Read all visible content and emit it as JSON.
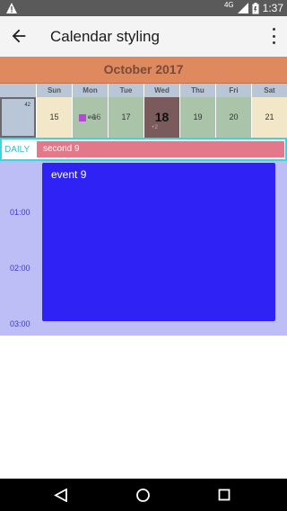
{
  "status_bar": {
    "time": "1:37",
    "network": "4G",
    "icons": [
      "warning-icon",
      "signal-icon",
      "battery-icon"
    ]
  },
  "app_bar": {
    "title": "Calendar styling",
    "icons": [
      "back-arrow-icon",
      "more-vert-icon"
    ]
  },
  "calendar": {
    "month_title": "October 2017",
    "weekdays": [
      "Sun",
      "Mon",
      "Tue",
      "Wed",
      "Thu",
      "Fri",
      "Sat"
    ],
    "week_number": "42",
    "days": [
      {
        "number": "15",
        "color": "#f2e8c8"
      },
      {
        "number": "16",
        "color": "#a9c4a8",
        "event_text": "eve",
        "event_color": "#b24ad6"
      },
      {
        "number": "17",
        "color": "#a9c4a8"
      },
      {
        "number": "18",
        "color": "#7a5a5a",
        "today": true,
        "extra": "+2"
      },
      {
        "number": "19",
        "color": "#a9c4a8"
      },
      {
        "number": "20",
        "color": "#a9c4a8"
      },
      {
        "number": "21",
        "color": "#f2e8c8"
      }
    ],
    "colors": {
      "header": "#df8a5e",
      "weekday_bar": "#b9c6d8",
      "week_number_cell": "#b9c6d8"
    }
  },
  "daily": {
    "label": "DAILY",
    "all_day_event": "second 9"
  },
  "timeline": {
    "times": [
      "01:00",
      "02:00",
      "03:00"
    ],
    "event": {
      "title": "event 9",
      "color": "#2f22f5"
    }
  },
  "nav_bar": {
    "icons": [
      "back-triangle-icon",
      "home-circle-icon",
      "recents-square-icon"
    ]
  }
}
